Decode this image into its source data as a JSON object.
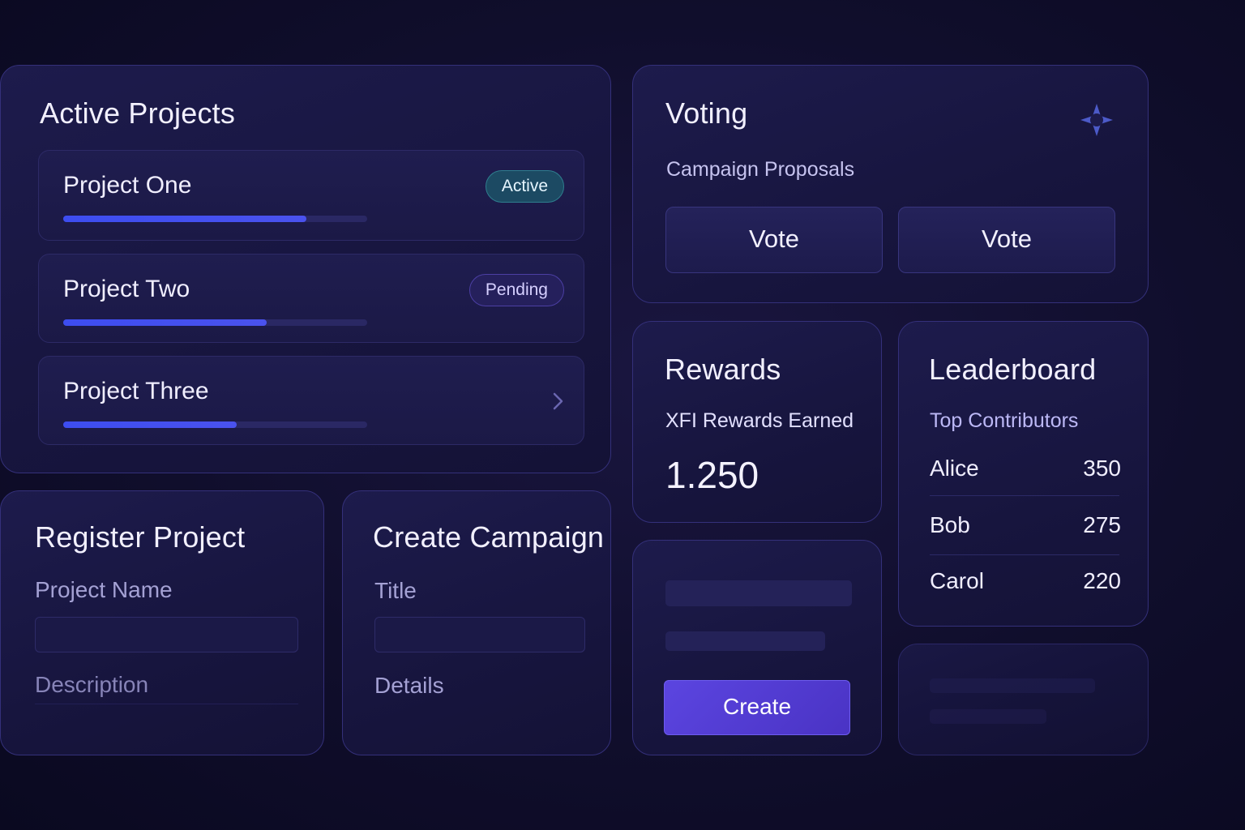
{
  "active_projects": {
    "title": "Active Projects",
    "projects": [
      {
        "name": "Project One",
        "progress": 0.8,
        "badge": "Active"
      },
      {
        "name": "Project Two",
        "progress": 0.67,
        "badge": "Pending"
      },
      {
        "name": "Project Three",
        "progress": 0.57
      }
    ]
  },
  "voting": {
    "title": "Voting",
    "subtitle": "Campaign Proposals",
    "buttons": [
      "Vote",
      "Vote"
    ],
    "icon": "compass-star-icon"
  },
  "rewards": {
    "title": "Rewards",
    "label": "XFI Rewards Earned",
    "value": "1.250"
  },
  "leaderboard": {
    "title": "Leaderboard",
    "subtitle": "Top Contributors",
    "entries": [
      {
        "name": "Alice",
        "score": "350"
      },
      {
        "name": "Bob",
        "score": "275"
      },
      {
        "name": "Carol",
        "score": "220"
      }
    ]
  },
  "register_project": {
    "title": "Register Project",
    "name_label": "Project Name",
    "description_label": "Description"
  },
  "create_campaign": {
    "title": "Create Campaign",
    "title_label": "Title",
    "details_label": "Details"
  },
  "create_card": {
    "button": "Create"
  },
  "colors": {
    "background": "#100e2c",
    "card": "#1b1946",
    "accent": "#4a52ee",
    "active_badge": "#1c4a63",
    "pending_badge": "#25205c",
    "create_button": "#5b45e0"
  }
}
